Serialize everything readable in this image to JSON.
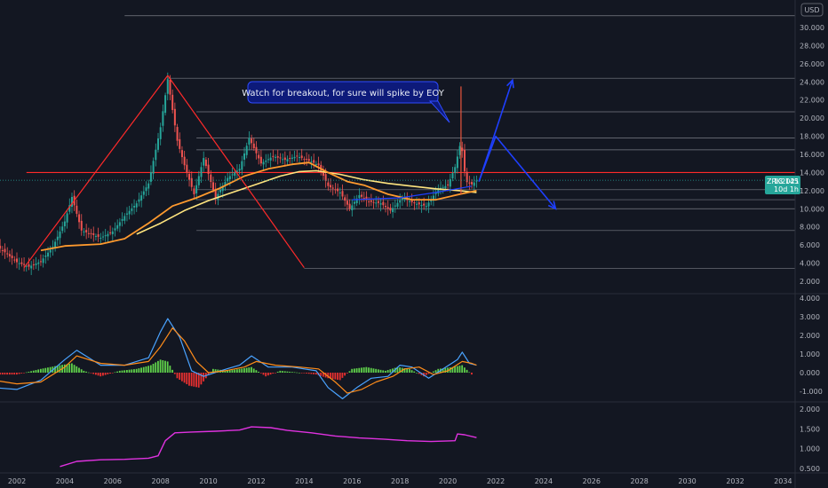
{
  "currency_label": "USD",
  "annotation": "Watch for breakout, for sure will spike by EOY",
  "symbol_badge": {
    "symbol": "ZRK2021",
    "price": "13.145",
    "countdown": "10d 1h"
  },
  "colors": {
    "background": "#131722",
    "candle_up": "#26a69a",
    "candle_down": "#ef5350",
    "trend": "#ff2a2a",
    "projection": "#1e3fff",
    "ma_slow": "#ffe57f",
    "ma_fast": "#ff9a2e",
    "macd": "#4aa3ff",
    "signal": "#ff8c1a",
    "ratio": "#e032e0",
    "badge": "#26a69a"
  },
  "chart_data": [
    {
      "type": "candlestick",
      "series_note": "weekly price candles with two moving averages, horizontal levels and drawn trend/projection lines",
      "x_unit": "year",
      "ylim": [
        2.0,
        31.5
      ],
      "x_ticks": [
        "2002",
        "2004",
        "2006",
        "2008",
        "2010",
        "2012",
        "2014",
        "2016",
        "2018",
        "2020",
        "2022",
        "2024",
        "2026",
        "2028",
        "2030",
        "2032",
        "2034"
      ],
      "y_ticks": [
        "2.000",
        "4.000",
        "6.000",
        "8.000",
        "10.000",
        "12.000",
        "14.000",
        "16.000",
        "18.000",
        "20.000",
        "22.000",
        "24.000",
        "26.000",
        "28.000",
        "30.000"
      ],
      "price_path": [
        [
          2001.0,
          6.2
        ],
        [
          2001.5,
          5.2
        ],
        [
          2002.0,
          4.1
        ],
        [
          2002.5,
          3.6
        ],
        [
          2003.0,
          4.2
        ],
        [
          2003.5,
          5.8
        ],
        [
          2004.0,
          8.6
        ],
        [
          2004.3,
          11.3
        ],
        [
          2004.7,
          7.6
        ],
        [
          2005.5,
          6.8
        ],
        [
          2006.0,
          7.5
        ],
        [
          2006.5,
          9.2
        ],
        [
          2007.0,
          10.6
        ],
        [
          2007.5,
          12.8
        ],
        [
          2008.0,
          19.0
        ],
        [
          2008.3,
          24.3
        ],
        [
          2008.7,
          17.5
        ],
        [
          2009.0,
          14.8
        ],
        [
          2009.4,
          11.6
        ],
        [
          2009.8,
          15.6
        ],
        [
          2010.3,
          11.2
        ],
        [
          2010.8,
          13.4
        ],
        [
          2011.3,
          14.4
        ],
        [
          2011.7,
          17.8
        ],
        [
          2012.2,
          15.0
        ],
        [
          2012.7,
          15.8
        ],
        [
          2013.2,
          15.4
        ],
        [
          2013.7,
          15.8
        ],
        [
          2014.3,
          15.2
        ],
        [
          2014.6,
          14.8
        ],
        [
          2015.0,
          12.5
        ],
        [
          2015.5,
          11.8
        ],
        [
          2015.9,
          10.0
        ],
        [
          2016.3,
          11.5
        ],
        [
          2016.7,
          10.8
        ],
        [
          2017.2,
          10.6
        ],
        [
          2017.6,
          9.8
        ],
        [
          2018.1,
          11.2
        ],
        [
          2018.6,
          10.6
        ],
        [
          2019.1,
          10.3
        ],
        [
          2019.6,
          12.2
        ],
        [
          2020.0,
          12.6
        ],
        [
          2020.3,
          14.6
        ],
        [
          2020.55,
          17.5
        ],
        [
          2020.75,
          13.0
        ],
        [
          2021.0,
          12.7
        ],
        [
          2021.25,
          13.2
        ]
      ],
      "ma_slow": [
        [
          2007.0,
          7.2
        ],
        [
          2008.0,
          8.4
        ],
        [
          2009.0,
          9.8
        ],
        [
          2010.0,
          10.9
        ],
        [
          2011.0,
          11.8
        ],
        [
          2012.0,
          12.7
        ],
        [
          2013.0,
          13.6
        ],
        [
          2013.8,
          14.1
        ],
        [
          2014.5,
          14.2
        ],
        [
          2015.5,
          13.8
        ],
        [
          2016.5,
          13.2
        ],
        [
          2017.5,
          12.8
        ],
        [
          2018.5,
          12.5
        ],
        [
          2019.5,
          12.2
        ],
        [
          2020.5,
          12.0
        ],
        [
          2021.2,
          11.8
        ]
      ],
      "ma_fast": [
        [
          2003.0,
          5.4
        ],
        [
          2004.0,
          5.9
        ],
        [
          2005.5,
          6.1
        ],
        [
          2006.5,
          6.7
        ],
        [
          2007.5,
          8.4
        ],
        [
          2008.5,
          10.3
        ],
        [
          2009.5,
          11.2
        ],
        [
          2010.5,
          12.3
        ],
        [
          2011.5,
          13.6
        ],
        [
          2012.5,
          14.4
        ],
        [
          2013.5,
          14.9
        ],
        [
          2014.2,
          15.1
        ],
        [
          2015.0,
          14.0
        ],
        [
          2015.8,
          13.0
        ],
        [
          2016.5,
          12.6
        ],
        [
          2017.5,
          11.6
        ],
        [
          2018.5,
          11.0
        ],
        [
          2019.5,
          11.0
        ],
        [
          2020.5,
          11.6
        ],
        [
          2021.2,
          12.0
        ]
      ],
      "levels": [
        31.3,
        24.4,
        20.7,
        17.8,
        16.5,
        14.0,
        12.1,
        11.0,
        10.0,
        7.6,
        3.4
      ],
      "trend_line_level": 14.0,
      "drawings": {
        "triangle": [
          [
            2002.3,
            3.5
          ],
          [
            2008.3,
            24.7
          ],
          [
            2014.0,
            3.5
          ]
        ],
        "spike_marker": [
          [
            2020.55,
            11.6
          ],
          [
            2020.55,
            23.5
          ]
        ],
        "projection_up": [
          [
            2021.3,
            13.0
          ],
          [
            2022.7,
            24.2
          ]
        ],
        "projection_down": [
          [
            2021.3,
            13.0
          ],
          [
            2022.0,
            18.0
          ],
          [
            2024.5,
            10.0
          ]
        ],
        "blue_channel": [
          [
            2016.0,
            11.0
          ],
          [
            2018.0,
            11.2
          ],
          [
            2019.5,
            11.8
          ],
          [
            2021.0,
            12.5
          ]
        ]
      },
      "last_price": 13.145
    },
    {
      "type": "line",
      "series_note": "oscillator pane: histogram with two signal lines",
      "ylim": [
        -1.0,
        4.0
      ],
      "y_ticks": [
        "-1.000",
        "0.000",
        "1.000",
        "2.000",
        "3.000",
        "4.000"
      ],
      "macd": [
        [
          2001.0,
          -0.8
        ],
        [
          2002.0,
          -0.9
        ],
        [
          2003.0,
          -0.4
        ],
        [
          2004.0,
          0.7
        ],
        [
          2004.5,
          1.2
        ],
        [
          2005.5,
          0.4
        ],
        [
          2006.5,
          0.4
        ],
        [
          2007.5,
          0.8
        ],
        [
          2008.0,
          2.2
        ],
        [
          2008.3,
          2.9
        ],
        [
          2008.8,
          1.9
        ],
        [
          2009.3,
          0.1
        ],
        [
          2009.8,
          -0.2
        ],
        [
          2010.5,
          0.1
        ],
        [
          2011.3,
          0.4
        ],
        [
          2011.8,
          0.9
        ],
        [
          2012.5,
          0.3
        ],
        [
          2013.5,
          0.3
        ],
        [
          2014.5,
          0.1
        ],
        [
          2015.0,
          -0.8
        ],
        [
          2015.6,
          -1.4
        ],
        [
          2016.2,
          -0.8
        ],
        [
          2016.8,
          -0.3
        ],
        [
          2017.5,
          -0.2
        ],
        [
          2018.0,
          0.4
        ],
        [
          2018.5,
          0.3
        ],
        [
          2019.2,
          -0.3
        ],
        [
          2019.8,
          0.2
        ],
        [
          2020.4,
          0.7
        ],
        [
          2020.6,
          1.1
        ],
        [
          2020.9,
          0.5
        ],
        [
          2021.2,
          0.4
        ]
      ],
      "signal": [
        [
          2001.0,
          -0.4
        ],
        [
          2002.0,
          -0.6
        ],
        [
          2003.0,
          -0.5
        ],
        [
          2004.0,
          0.3
        ],
        [
          2004.5,
          0.9
        ],
        [
          2005.5,
          0.5
        ],
        [
          2006.5,
          0.4
        ],
        [
          2007.5,
          0.6
        ],
        [
          2008.0,
          1.4
        ],
        [
          2008.5,
          2.4
        ],
        [
          2009.0,
          1.7
        ],
        [
          2009.5,
          0.6
        ],
        [
          2010.0,
          0.0
        ],
        [
          2010.7,
          0.1
        ],
        [
          2011.5,
          0.3
        ],
        [
          2012.0,
          0.6
        ],
        [
          2012.8,
          0.4
        ],
        [
          2013.8,
          0.3
        ],
        [
          2014.6,
          0.2
        ],
        [
          2015.3,
          -0.5
        ],
        [
          2015.8,
          -1.1
        ],
        [
          2016.4,
          -0.9
        ],
        [
          2017.0,
          -0.5
        ],
        [
          2017.7,
          -0.2
        ],
        [
          2018.2,
          0.2
        ],
        [
          2018.8,
          0.3
        ],
        [
          2019.4,
          -0.1
        ],
        [
          2020.0,
          0.1
        ],
        [
          2020.6,
          0.6
        ],
        [
          2021.0,
          0.5
        ],
        [
          2021.2,
          0.4
        ]
      ],
      "histogram": [
        [
          2001.2,
          -0.1
        ],
        [
          2002.0,
          -0.1
        ],
        [
          2003.0,
          0.2
        ],
        [
          2003.8,
          0.4
        ],
        [
          2004.3,
          0.5
        ],
        [
          2004.8,
          0.1
        ],
        [
          2005.5,
          -0.2
        ],
        [
          2006.3,
          0.1
        ],
        [
          2007.0,
          0.2
        ],
        [
          2007.6,
          0.4
        ],
        [
          2008.0,
          0.7
        ],
        [
          2008.3,
          0.6
        ],
        [
          2008.7,
          -0.3
        ],
        [
          2009.2,
          -0.7
        ],
        [
          2009.6,
          -0.8
        ],
        [
          2010.2,
          0.2
        ],
        [
          2010.8,
          0.1
        ],
        [
          2011.3,
          0.2
        ],
        [
          2011.8,
          0.3
        ],
        [
          2012.4,
          -0.2
        ],
        [
          2013.0,
          0.1
        ],
        [
          2013.8,
          0.0
        ],
        [
          2014.5,
          -0.1
        ],
        [
          2015.0,
          -0.3
        ],
        [
          2015.5,
          -0.4
        ],
        [
          2016.0,
          0.2
        ],
        [
          2016.6,
          0.3
        ],
        [
          2017.4,
          0.1
        ],
        [
          2017.9,
          0.3
        ],
        [
          2018.4,
          0.2
        ],
        [
          2019.0,
          -0.2
        ],
        [
          2019.6,
          0.2
        ],
        [
          2020.2,
          0.3
        ],
        [
          2020.6,
          0.4
        ],
        [
          2021.0,
          -0.1
        ]
      ]
    },
    {
      "type": "line",
      "series_note": "ratio pane",
      "ylim": [
        0.45,
        2.0
      ],
      "y_ticks": [
        "0.500",
        "1.000",
        "1.500",
        "2.000"
      ],
      "values": [
        [
          2003.8,
          0.55
        ],
        [
          2004.5,
          0.68
        ],
        [
          2005.5,
          0.72
        ],
        [
          2006.5,
          0.73
        ],
        [
          2007.5,
          0.76
        ],
        [
          2007.9,
          0.82
        ],
        [
          2008.2,
          1.2
        ],
        [
          2008.6,
          1.4
        ],
        [
          2009.3,
          1.42
        ],
        [
          2010.3,
          1.44
        ],
        [
          2011.3,
          1.47
        ],
        [
          2011.8,
          1.55
        ],
        [
          2012.6,
          1.53
        ],
        [
          2013.3,
          1.46
        ],
        [
          2014.3,
          1.4
        ],
        [
          2015.3,
          1.32
        ],
        [
          2016.3,
          1.27
        ],
        [
          2017.3,
          1.24
        ],
        [
          2018.3,
          1.2
        ],
        [
          2019.3,
          1.18
        ],
        [
          2020.3,
          1.2
        ],
        [
          2020.4,
          1.37
        ],
        [
          2020.7,
          1.35
        ],
        [
          2021.2,
          1.28
        ]
      ]
    }
  ]
}
